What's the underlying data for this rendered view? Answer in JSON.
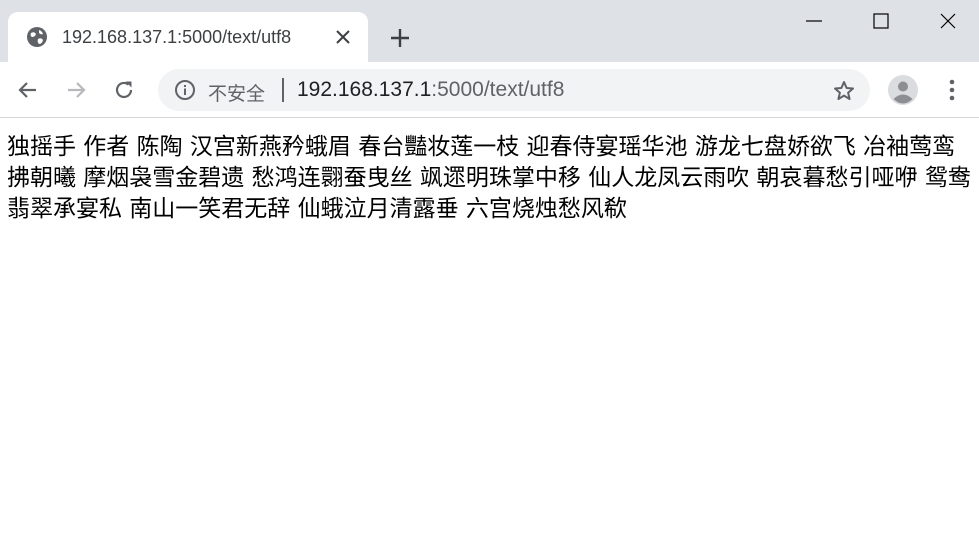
{
  "tab": {
    "title": "192.168.137.1:5000/text/utf8",
    "favicon_icon": "globe-icon",
    "close_icon": "close-icon"
  },
  "toolbar": {
    "new_tab_icon": "plus-icon",
    "back_icon": "arrow-left-icon",
    "forward_icon": "arrow-right-icon",
    "reload_icon": "reload-icon",
    "menu_icon": "kebab-menu-icon",
    "profile_icon": "avatar-icon"
  },
  "omnibox": {
    "security_label": "不安全",
    "url_host": "192.168.137.1",
    "url_path": ":5000/text/utf8",
    "bookmark_icon": "star-icon",
    "info_icon": "info-icon"
  },
  "window_controls": {
    "minimize_icon": "minimize-icon",
    "maximize_icon": "maximize-icon",
    "close_icon": "close-icon"
  },
  "page": {
    "text": "独摇手 作者 陈陶 汉宫新燕矜蛾眉 春台豔妆莲一枝 迎春侍宴瑶华池 游龙七盘娇欲飞 冶袖莺鸾拂朝曦 摩烟袅雪金碧遗 愁鸿连翾蚕曳丝 飒遝明珠掌中移 仙人龙凤云雨吹 朝哀暮愁引哑咿 鸳鸯翡翠承宴私 南山一笑君无辞 仙蛾泣月清露垂 六宫烧烛愁风欷"
  },
  "colors": {
    "tabstrip_bg": "#dee1e6",
    "omnibox_bg": "#f1f3f4",
    "icon_gray": "#5f6368",
    "forward_disabled": "#b6b8bb"
  }
}
